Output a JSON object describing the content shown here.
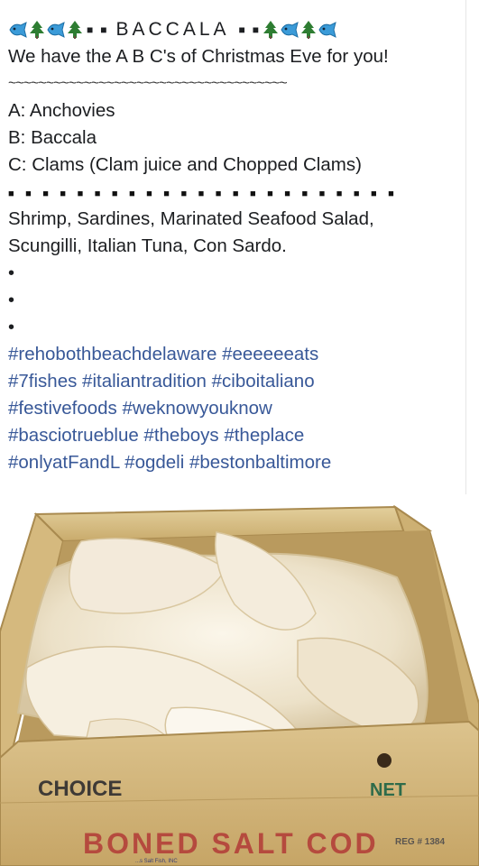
{
  "header": {
    "emoji_left": [
      "fish",
      "tree",
      "fish",
      "tree"
    ],
    "emoji_right": [
      "tree",
      "fish",
      "tree",
      "fish"
    ],
    "title": "BACCALA"
  },
  "intro": "We have the A  B  C's of Christmas Eve for you!",
  "tilde_rule": "~~~~~~~~~~~~~~~~~~~~~~~~~~~~~~~~~~~~~",
  "abc_list": [
    "A:  Anchovies",
    "B:  Baccala",
    "C:  Clams (Clam juice and Chopped Clams)"
  ],
  "more": [
    "Shrimp, Sardines, Marinated Seafood Salad,",
    "Scungilli, Italian Tuna, Con Sardo."
  ],
  "bullets": [
    "•",
    "•",
    "•"
  ],
  "hashtag_lines": [
    "#rehobothbeachdelaware #eeeeeeats",
    "#7fishes #italiantradition #ciboitaliano",
    "#festivefoods #weknowyouknow",
    "#basciotrueblue #theboys #theplace",
    "#onlyatFandL #ogdeli #bestonbaltimore"
  ],
  "photo": {
    "crate_label_left": "CHOICE",
    "crate_label_right": "NET",
    "crate_label_main": "BONED SALT COD",
    "crate_label_small": "REG # 1384",
    "crate_label_tiny": "...s Salt Fish, INC"
  },
  "colors": {
    "hashtag": "#385898",
    "text": "#1c1e21",
    "wood": "#d2b77c",
    "fish": "#efe6d2"
  }
}
